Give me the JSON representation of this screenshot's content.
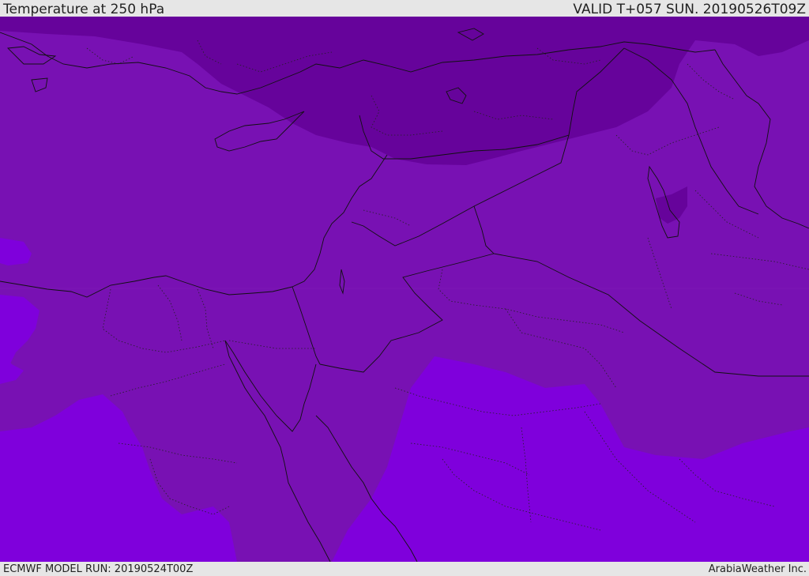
{
  "header": {
    "title": "Temperature at 250 hPa",
    "valid": "VALID T+057 SUN. 20190526T09Z"
  },
  "footer": {
    "model_run": "ECMWF MODEL RUN: 20190524T00Z",
    "brand": "ArabiaWeather Inc."
  },
  "map": {
    "field": "temperature-250hPa",
    "colors": {
      "cold_band": "#66039b",
      "mid_band": "#7811b3",
      "warm_band": "#7f00dc",
      "coastline": "#111111",
      "border": "#111111",
      "admin_border": "#222222"
    }
  }
}
